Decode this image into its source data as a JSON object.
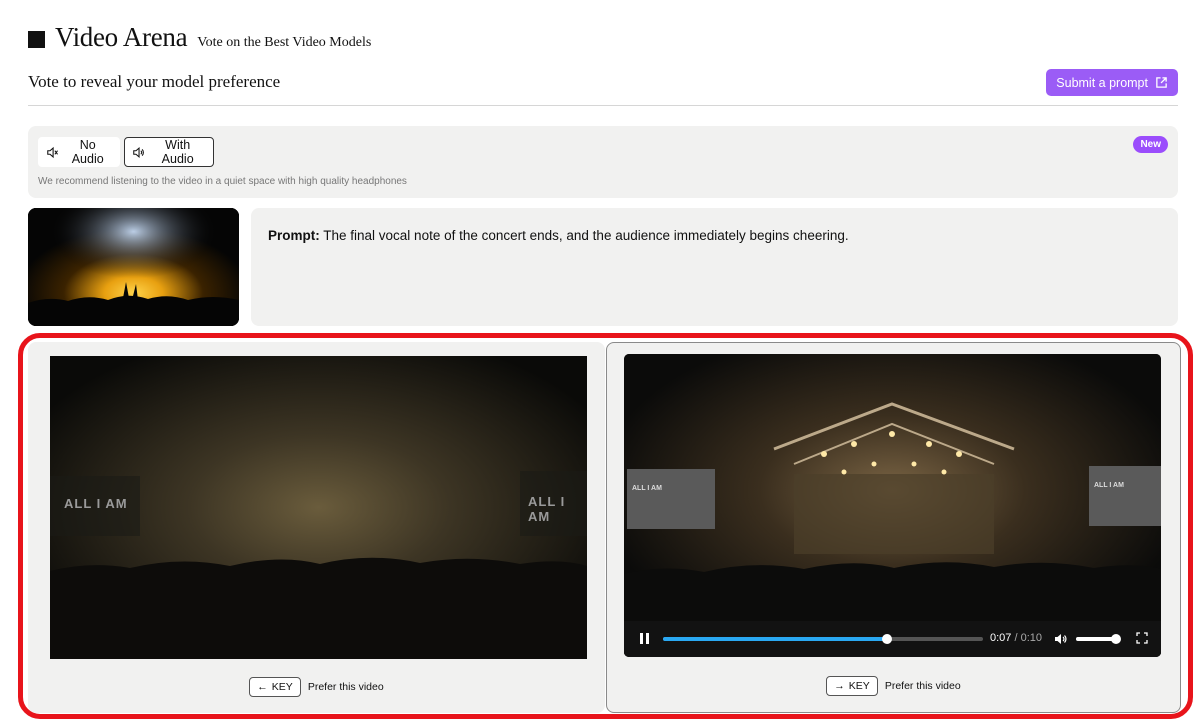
{
  "header": {
    "title": "Video Arena",
    "subtitle": "Vote on the Best Video Models"
  },
  "subheader": {
    "title": "Vote to reveal your model preference",
    "submit_label": "Submit a prompt",
    "submit_icon": "external-link-icon"
  },
  "audio": {
    "no_audio_label": "No Audio",
    "with_audio_label": "With Audio",
    "selected": "With Audio",
    "note": "We recommend listening to the video in a quiet space with high quality headphones",
    "badge": "New"
  },
  "prompt": {
    "label": "Prompt:",
    "text": "The final vocal note of the concert ends, and the audience immediately begins cheering."
  },
  "videos": [
    {
      "side": "left",
      "screen_text": "ALL I AM",
      "key_label": "KEY",
      "key_arrow": "←",
      "vote_label": "Prefer this video"
    },
    {
      "side": "right",
      "screen_text": "ALL I AM",
      "key_label": "KEY",
      "key_arrow": "→",
      "vote_label": "Prefer this video",
      "player": {
        "current_time": "0:07",
        "duration": "0:10",
        "progress": 0.7,
        "volume": 0.9,
        "state": "playing"
      }
    }
  ],
  "colors": {
    "accent": "#9b5cf6",
    "badge": "#9b4dfc",
    "highlight_border": "#e8141b",
    "progress": "#2aa8f2",
    "panel_bg": "#f1f1f0"
  }
}
